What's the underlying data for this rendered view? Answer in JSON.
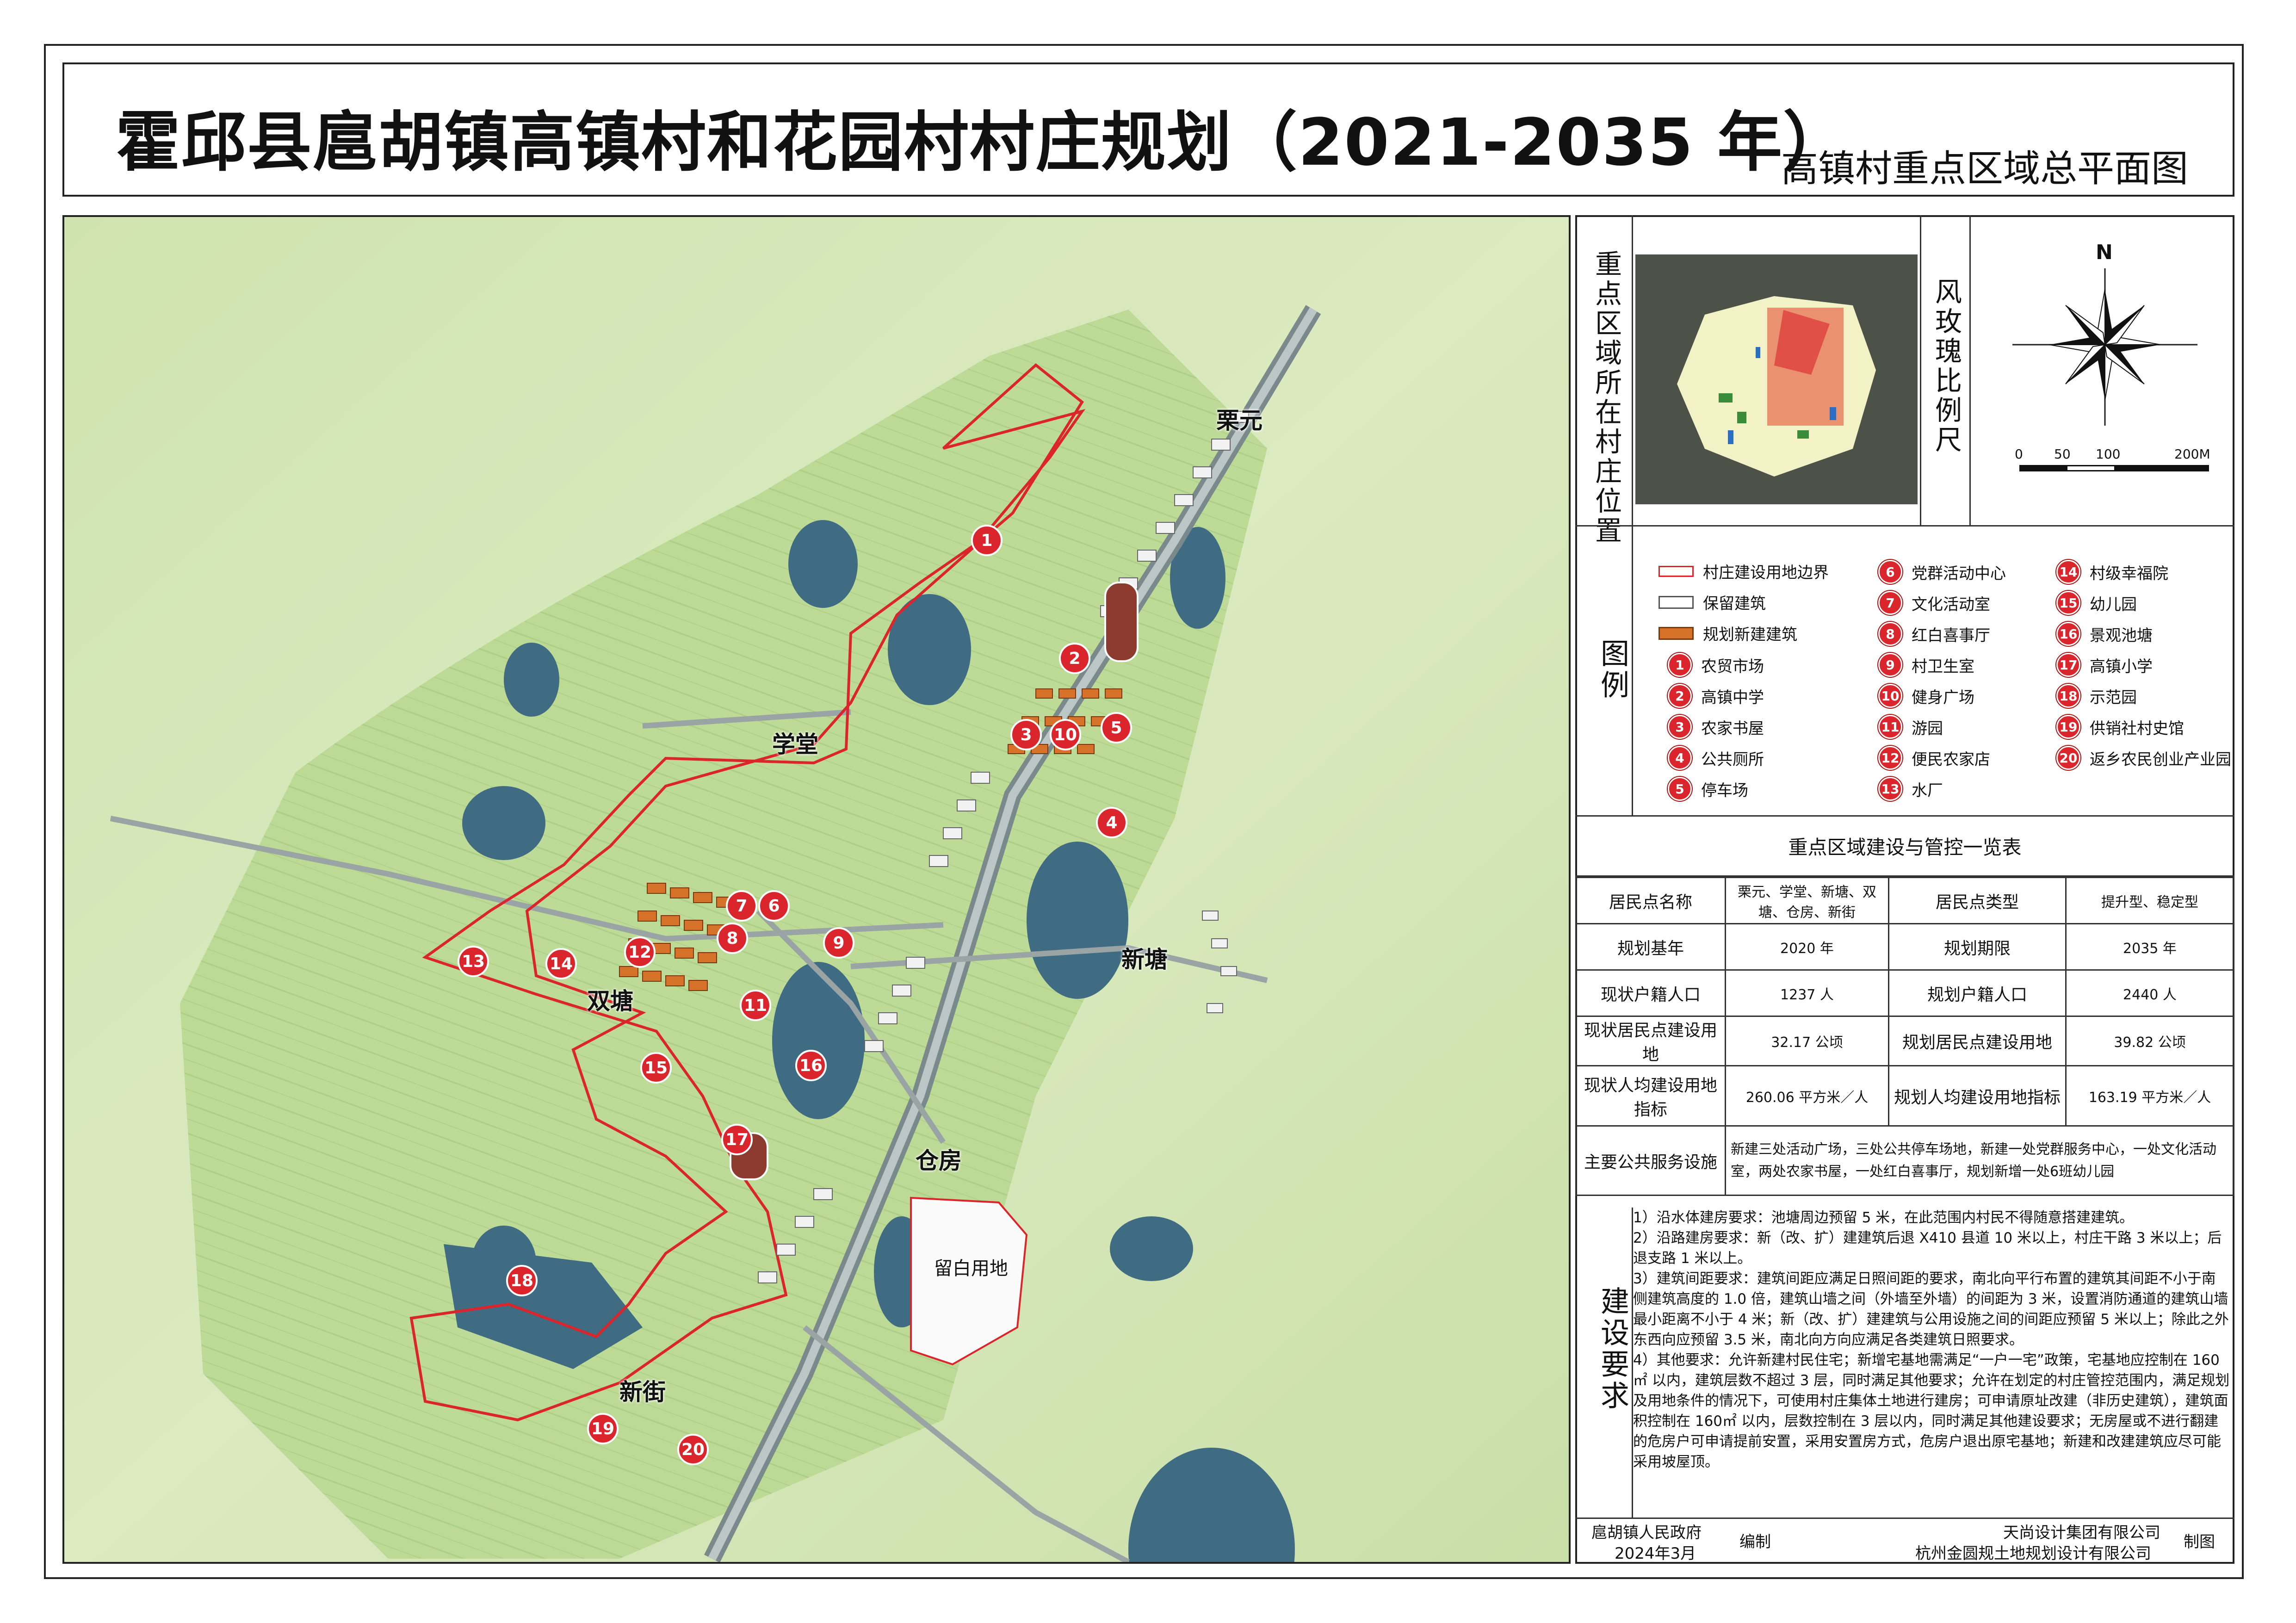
{
  "title": "霍邱县扈胡镇高镇村和花园村村庄规划（2021-2035 年）",
  "subtitle": "高镇村重点区域总平面图",
  "location_heading": "重点区域所在村庄位置",
  "rose_heading": "风玫瑰比例尺",
  "compass_north": "N",
  "scale_labels": [
    "0",
    "50",
    "100",
    "200M"
  ],
  "legend_heading": "图例",
  "legend": [
    {
      "label": "村庄建设用地边界",
      "swatch": "boundary"
    },
    {
      "label": "保留建筑",
      "swatch": "retained"
    },
    {
      "label": "规划新建建筑",
      "swatch": "new"
    },
    {
      "num": "1",
      "label": "农贸市场"
    },
    {
      "num": "2",
      "label": "高镇中学"
    },
    {
      "num": "3",
      "label": "农家书屋"
    },
    {
      "num": "4",
      "label": "公共厕所"
    },
    {
      "num": "5",
      "label": "停车场"
    },
    {
      "num": "6",
      "label": "党群活动中心"
    },
    {
      "num": "7",
      "label": "文化活动室"
    },
    {
      "num": "8",
      "label": "红白喜事厅"
    },
    {
      "num": "9",
      "label": "村卫生室"
    },
    {
      "num": "10",
      "label": "健身广场"
    },
    {
      "num": "11",
      "label": "游园"
    },
    {
      "num": "12",
      "label": "便民农家店"
    },
    {
      "num": "13",
      "label": "水厂"
    },
    {
      "num": "14",
      "label": "村级幸福院"
    },
    {
      "num": "15",
      "label": "幼儿园"
    },
    {
      "num": "16",
      "label": "景观池塘"
    },
    {
      "num": "17",
      "label": "高镇小学"
    },
    {
      "num": "18",
      "label": "示范园"
    },
    {
      "num": "19",
      "label": "供销社村史馆"
    },
    {
      "num": "20",
      "label": "返乡农民创业产业园"
    }
  ],
  "table": {
    "heading": "重点区域建设与管控一览表",
    "rows": [
      [
        "居民点名称",
        "栗元、学堂、新塘、双塘、仓房、新街",
        "居民点类型",
        "提升型、稳定型"
      ],
      [
        "规划基年",
        "2020 年",
        "规划期限",
        "2035 年"
      ],
      [
        "现状户籍人口",
        "1237 人",
        "规划户籍人口",
        "2440 人"
      ],
      [
        "现状居民点建设用地",
        "32.17 公顷",
        "规划居民点建设用地",
        "39.82 公顷"
      ],
      [
        "现状人均建设用地指标",
        "260.06 平方米／人",
        "规划人均建设用地指标",
        "163.19 平方米／人"
      ]
    ],
    "facilities_label": "主要公共服务设施",
    "facilities_text": "新建三处活动广场，三处公共停车场地，新建一处党群服务中心，一处文化活动室，两处农家书屋，一处红白喜事厅，规划新增一处6班幼儿园"
  },
  "requirements_heading": "建设要求",
  "requirements": [
    "1）沿水体建房要求：池塘周边预留 5 米，在此范围内村民不得随意搭建建筑。",
    "2）沿路建房要求：新（改、扩）建建筑后退 X410 县道 10 米以上，村庄干路 3 米以上；后退支路 1 米以上。",
    "3）建筑间距要求：建筑间距应满足日照间距的要求，南北向平行布置的建筑其间距不小于南侧建筑高度的 1.0 倍，建筑山墙之间（外墙至外墙）的间距为 3 米，设置消防通道的建筑山墙最小距离不小于 4 米；新（改、扩）建建筑与公用设施之间的间距应预留 5 米以上；除此之外东西向应预留 3.5 米，南北向方向应满足各类建筑日照要求。",
    "4）其他要求：允许新建村民住宅；新增宅基地需满足“一户一宅”政策，宅基地应控制在 160㎡ 以内，建筑层数不超过 3 层，同时满足其他要求；允许在划定的村庄管控范围内，满足规划及用地条件的情况下，可使用村庄集体土地进行建房；可申请原址改建（非历史建筑），建筑面积控制在 160㎡ 以内，层数控制在 3 层以内，同时满足其他建设要求；无房屋或不进行翻建的危房户可申请提前安置，采用安置房方式，危房户退出原宅基地；新建和改建建筑应尽可能采用坡屋顶。"
  ],
  "footer": {
    "gov": "扈胡镇人民政府",
    "date": "2024年3月",
    "compile": "编制",
    "company1": "天尚设计集团有限公司",
    "company2": "杭州金圆规土地规划设计有限公司",
    "draw": "制图"
  },
  "map_labels": [
    {
      "text": "栗元",
      "name": "place-liyuan"
    },
    {
      "text": "学堂",
      "name": "place-xuetang"
    },
    {
      "text": "双塘",
      "name": "place-shuangtang"
    },
    {
      "text": "新塘",
      "name": "place-xintang"
    },
    {
      "text": "仓房",
      "name": "place-cangfang"
    },
    {
      "text": "新街",
      "name": "place-xinjie"
    },
    {
      "text": "留白用地",
      "name": "reserved-land-label"
    }
  ],
  "map_markers": [
    "1",
    "2",
    "3",
    "4",
    "5",
    "6",
    "7",
    "8",
    "9",
    "10",
    "11",
    "12",
    "13",
    "14",
    "15",
    "16",
    "17",
    "18",
    "19",
    "20"
  ]
}
